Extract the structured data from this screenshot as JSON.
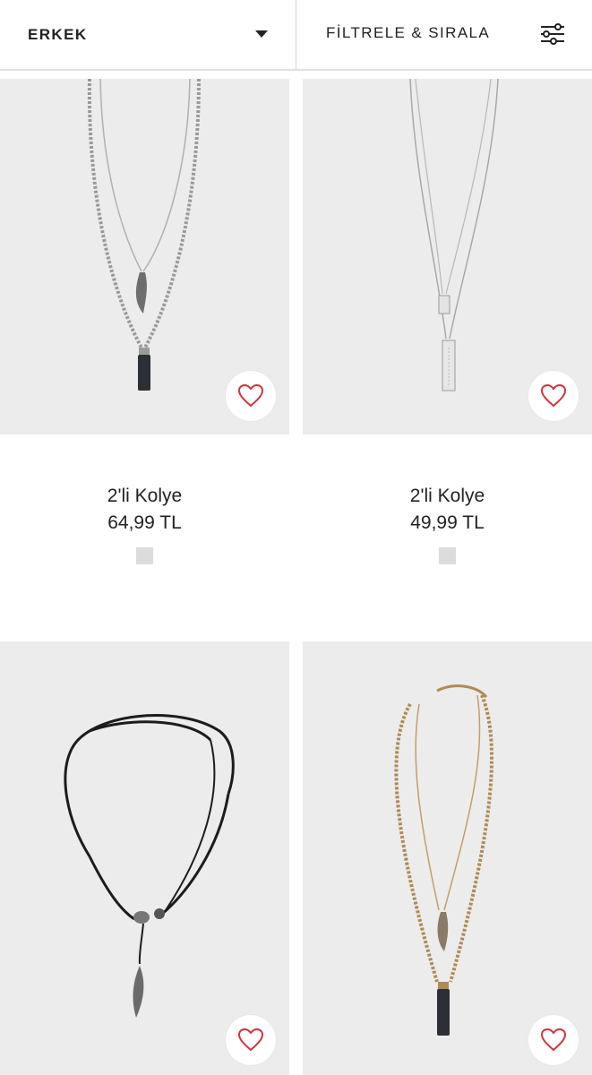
{
  "header": {
    "department_label": "ERKEK",
    "filter_label": "FİLTRELE & SIRALA"
  },
  "products": [
    {
      "name": "2'li Kolye",
      "price": "64,99 TL",
      "swatch_color": "#dcdcdc"
    },
    {
      "name": "2'li Kolye",
      "price": "49,99 TL",
      "swatch_color": "#dcdcdc"
    }
  ],
  "colors": {
    "heart": "#d0343b",
    "image_background": "#ececec"
  }
}
